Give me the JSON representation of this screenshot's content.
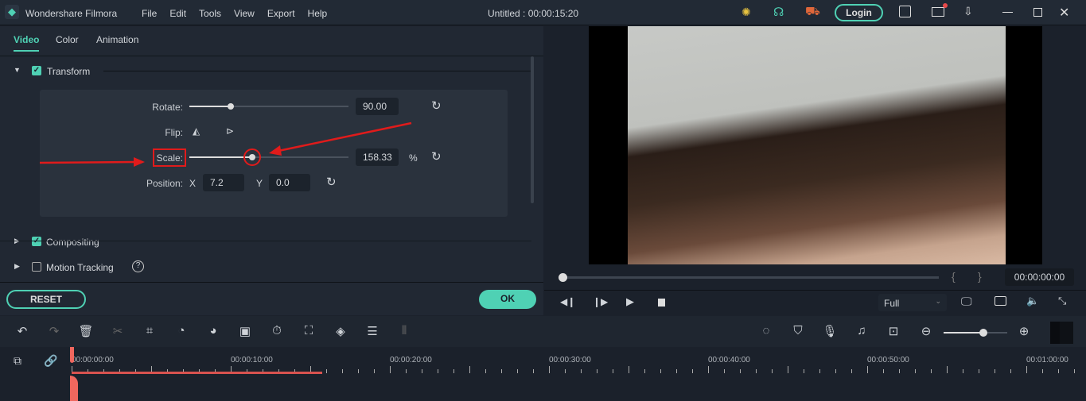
{
  "app": {
    "name": "Wondershare Filmora",
    "title": "Untitled : 00:00:15:20",
    "menu": [
      "File",
      "Edit",
      "Tools",
      "View",
      "Export",
      "Help"
    ],
    "login_label": "Login",
    "accent": "#4fd1b4"
  },
  "tabs": [
    "Video",
    "Color",
    "Animation"
  ],
  "sections": {
    "transform": "Transform",
    "compositing": "Compositing",
    "motion_tracking": "Motion Tracking"
  },
  "transform": {
    "rotate_label": "Rotate:",
    "rotate_value": "90.00",
    "rotate_fraction": 0.26,
    "flip_label": "Flip:",
    "scale_label": "Scale:",
    "scale_value": "158.33",
    "scale_unit": "%",
    "scale_fraction": 0.4,
    "position_label": "Position:",
    "x_label": "X",
    "x_value": "7.2",
    "y_label": "Y",
    "y_value": "0.0"
  },
  "buttons": {
    "reset": "RESET",
    "ok": "OK"
  },
  "preview": {
    "timecode": "00:00:00:00",
    "quality": "Full",
    "bracket_in": "{",
    "bracket_out": "}"
  },
  "timeline": {
    "labels": [
      "00:00:00:00",
      "00:00:10:00",
      "00:00:20:00",
      "00:00:30:00",
      "00:00:40:00",
      "00:00:50:00",
      "00:01:00:00"
    ]
  }
}
